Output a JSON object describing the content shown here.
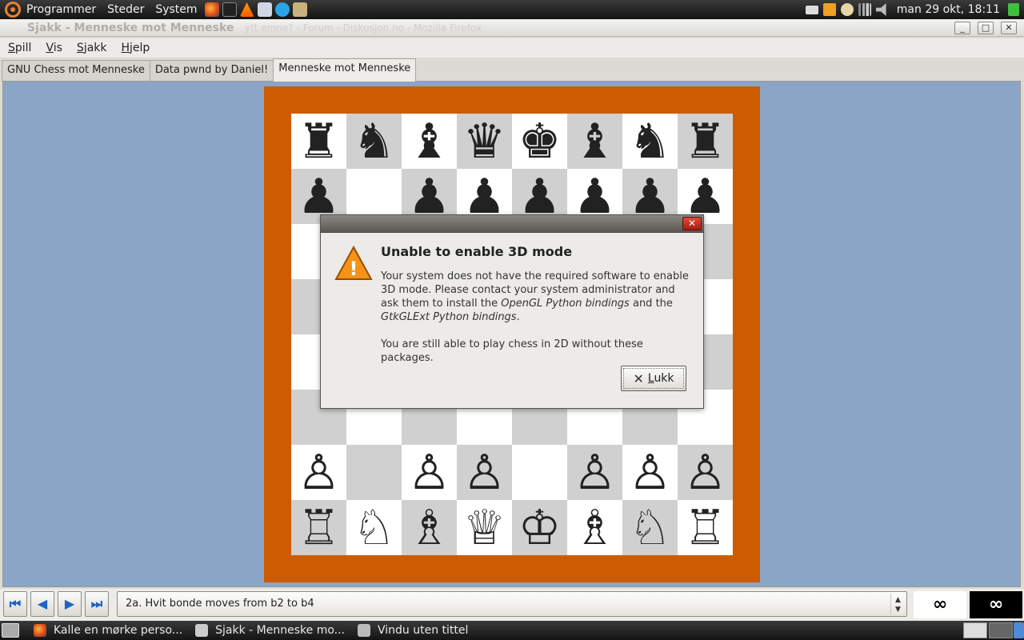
{
  "top_panel": {
    "menus": [
      "Programmer",
      "Steder",
      "System"
    ],
    "clock": "man 29 okt, 18:11",
    "launchers": [
      "firefox-icon",
      "terminal-icon",
      "vlc-icon",
      "mail-client-icon",
      "skype-icon",
      "people-icon"
    ],
    "tray": [
      "mail-icon",
      "notes-icon",
      "user-icon",
      "network-signal-icon",
      "volume-icon"
    ]
  },
  "window": {
    "title": "Sjakk - Menneske  mot Menneske",
    "background_title": "ytt emne? - Forum - Diskusjon.no - Mozilla Firefox",
    "controls": {
      "minimize": "_",
      "maximize": "□",
      "close": "✕"
    }
  },
  "menubar": [
    {
      "label": "Spill",
      "mnemonic": "S",
      "rest": "pill"
    },
    {
      "label": "Vis",
      "mnemonic": "V",
      "rest": "is"
    },
    {
      "label": "Sjakk",
      "mnemonic": "S",
      "rest": "jakk"
    },
    {
      "label": "Hjelp",
      "mnemonic": "H",
      "rest": "jelp"
    }
  ],
  "tabs": [
    {
      "label": "GNU Chess  mot Menneske",
      "active": false
    },
    {
      "label": "Data pwnd by Daniel!",
      "active": false
    },
    {
      "label": "Menneske  mot Menneske",
      "active": true
    }
  ],
  "board": {
    "rows": [
      [
        "♜",
        "♞",
        "♝",
        "♛",
        "♚",
        "♝",
        "♞",
        "♜"
      ],
      [
        "♟",
        "",
        "♟",
        "♟",
        "♟",
        "♟",
        "♟",
        "♟"
      ],
      [
        "",
        "",
        "",
        "",
        "",
        "",
        "",
        ""
      ],
      [
        "",
        "",
        "",
        "",
        "",
        "",
        "",
        ""
      ],
      [
        "",
        "",
        "",
        "",
        "",
        "",
        "",
        ""
      ],
      [
        "",
        "",
        "",
        "",
        "",
        "",
        "",
        ""
      ],
      [
        "♙",
        "",
        "♙",
        "♙",
        "",
        "♙",
        "♙",
        "♙"
      ],
      [
        "♖",
        "♘",
        "♗",
        "♕",
        "♔",
        "♗",
        "♘",
        "♖"
      ]
    ]
  },
  "dialog": {
    "close_glyph": "✕",
    "warn_glyph": "!",
    "heading": "Unable to enable 3D mode",
    "para1_a": "Your system does not have the required software to enable 3D mode. Please contact your system administrator and ask them to install the ",
    "para1_i1": "OpenGL Python bindings",
    "para1_b": " and the ",
    "para1_i2": "GtkGLExt Python bindings",
    "para1_c": ".",
    "para2": "You are still able to play chess in 2D without these packages.",
    "button_label": "Lukk",
    "button_mnemonic": "L",
    "button_rest": "ukk",
    "button_glyph": "✕"
  },
  "navigation": {
    "first": "⏮",
    "prev": "◀",
    "next": "▶",
    "last": "⏭",
    "move_text": "2a. Hvit bonde moves from b2 to b4",
    "combo_up": "▲",
    "combo_down": "▼",
    "white_clock": "∞",
    "black_clock": "∞"
  },
  "taskbar": {
    "tasks": [
      {
        "label": "Kalle en mørke perso...",
        "icon": "firefox-icon"
      },
      {
        "label": "Sjakk - Menneske  mo...",
        "icon": "chess-icon"
      },
      {
        "label": "Vindu uten tittel",
        "icon": "window-icon"
      }
    ]
  },
  "colors": {
    "board_frame": "#cd5c00",
    "board_area": "#8aa5c5",
    "dark_square": "#d0d0d0",
    "light_square": "#ffffff"
  }
}
